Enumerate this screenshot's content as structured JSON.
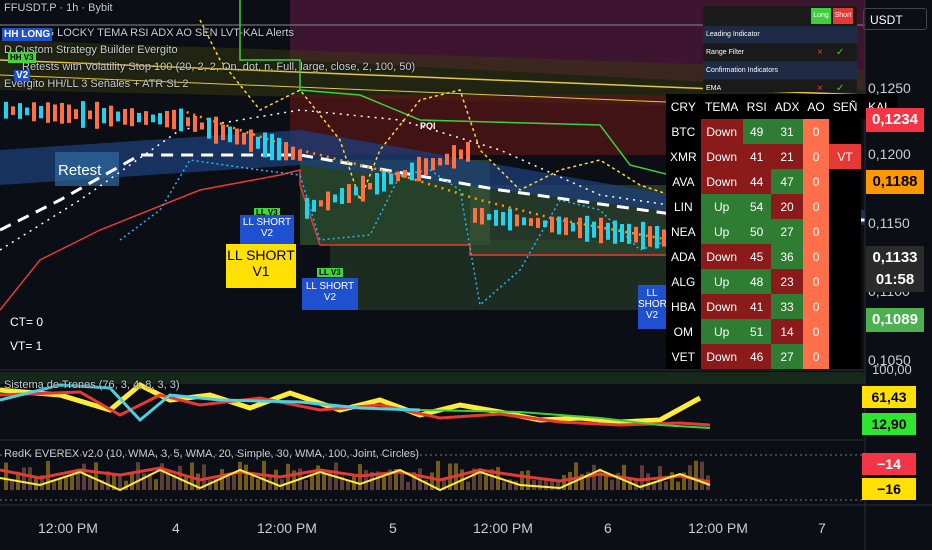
{
  "header": {
    "symbol_line": "FFUSDT.P · 1h · Bybit",
    "currency": "USDT",
    "poi": "POI"
  },
  "legends": [
    "HH LONG  LOCKY TEMA RSI ADX AO SEN LVT-KAL Alerts",
    "D Custom Strategy Builder Evergito",
    "Retests with Volatility Stop 100 (20, 2, 2, On, dot, n, Full, large, close, 2, 100, 50)",
    "Evergito HH/LL 3 Señales + ATR SL 2"
  ],
  "price_axis": {
    "labels": [
      "0,1250",
      "0,1200",
      "0,1150",
      "0,1100",
      "0,1050"
    ],
    "tags": [
      {
        "value": "0,1234",
        "bg": "#f23645",
        "fg": "#ffffff"
      },
      {
        "value": "0,1188",
        "bg": "#ff9800",
        "fg": "#000000"
      },
      {
        "value": "0,1133",
        "bg": "#2b2b2b",
        "fg": "#ffffff"
      },
      {
        "value": "01:58",
        "bg": "#2b2b2b",
        "fg": "#ffffff"
      },
      {
        "value": "0,1089",
        "bg": "#4caf50",
        "fg": "#ffffff"
      }
    ]
  },
  "time_axis": [
    "12:00 PM",
    "4",
    "12:00 PM",
    "5",
    "12:00 PM",
    "6",
    "12:00 PM",
    "7"
  ],
  "signals": {
    "hh_long": "HH LONG",
    "hh_v3": "HH V3",
    "v2": "V2",
    "retest": "Retest",
    "ll_v3": "LL V3",
    "ll_short_v2": "LL SHORT V2",
    "ll_short_v1": "LL SHORT V1",
    "ll_short": "LL SHORT",
    "v1": "V1"
  },
  "counters": {
    "ct": "CT=  0",
    "vt": "VT=  1"
  },
  "panel": {
    "long_btn": "Long",
    "short_btn": "Short",
    "rows": [
      "Leading Indicator",
      "Range Filter",
      "Confirmation Indicators",
      "EMA"
    ],
    "x": "×",
    "check": "✓"
  },
  "screener": {
    "headers": [
      "CRY",
      "TEMA",
      "RSI",
      "ADX",
      "AO",
      "SEÑ",
      "KAL"
    ],
    "rows": [
      {
        "cry": "BTC",
        "tema": "Down",
        "rsi": "49",
        "adx": "31",
        "ao": "0",
        "sen": ""
      },
      {
        "cry": "XMR",
        "tema": "Down",
        "rsi": "41",
        "adx": "21",
        "ao": "0",
        "sen": "VT"
      },
      {
        "cry": "AVA",
        "tema": "Down",
        "rsi": "44",
        "adx": "47",
        "ao": "0",
        "sen": ""
      },
      {
        "cry": "LIN",
        "tema": "Up",
        "rsi": "54",
        "adx": "20",
        "ao": "0",
        "sen": ""
      },
      {
        "cry": "NEA",
        "tema": "Up",
        "rsi": "50",
        "adx": "27",
        "ao": "0",
        "sen": ""
      },
      {
        "cry": "ADA",
        "tema": "Down",
        "rsi": "45",
        "adx": "36",
        "ao": "0",
        "sen": ""
      },
      {
        "cry": "ALG",
        "tema": "Up",
        "rsi": "48",
        "adx": "23",
        "ao": "0",
        "sen": ""
      },
      {
        "cry": "HBA",
        "tema": "Down",
        "rsi": "41",
        "adx": "33",
        "ao": "0",
        "sen": ""
      },
      {
        "cry": "OM",
        "tema": "Up",
        "rsi": "51",
        "adx": "14",
        "ao": "0",
        "sen": ""
      },
      {
        "cry": "VET",
        "tema": "Down",
        "rsi": "46",
        "adx": "27",
        "ao": "0",
        "sen": ""
      }
    ]
  },
  "sub1": {
    "title": "Sistema de Trenes (76, 3, 4, 8, 3, 3)",
    "top": "100,00",
    "v1": "61,43",
    "v2": "12,90"
  },
  "sub2": {
    "title": "RedK EVEREX v2.0 (10, WMA, 3, 5, WMA, 20, Simple, 30, WMA, 100, Joint, Circles)",
    "v1": "−14",
    "v2": "−16"
  },
  "colors": {
    "up": "#26a69a",
    "down": "#ef5350",
    "green": "#4caf50",
    "red": "#b71c1c",
    "yellow": "#ffeb3b",
    "blue": "#1e50d0"
  }
}
